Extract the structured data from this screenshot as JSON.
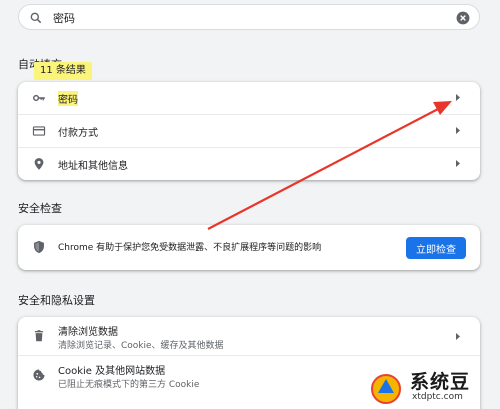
{
  "search": {
    "value": "密码",
    "icon": "search-icon",
    "clear_icon": "clear-icon"
  },
  "autofill": {
    "title": "自动填充",
    "tooltip": "11 条结果",
    "items": [
      {
        "label": "密码",
        "icon": "key-icon",
        "highlighted": true
      },
      {
        "label": "付款方式",
        "icon": "credit-card-icon"
      },
      {
        "label": "地址和其他信息",
        "icon": "location-pin-icon"
      }
    ]
  },
  "safety": {
    "title": "安全检查",
    "text": "Chrome 有助于保护您免受数据泄露、不良扩展程序等问题的影响",
    "button": "立即检查",
    "icon": "shield-icon"
  },
  "privacy": {
    "title": "安全和隐私设置",
    "items": [
      {
        "label": "清除浏览数据",
        "sub": "清除浏览记录、Cookie、缓存及其他数据",
        "icon": "trash-icon"
      },
      {
        "label": "Cookie 及其他网站数据",
        "sub": "已阻止无痕模式下的第三方 Cookie",
        "icon": "cookie-icon"
      }
    ]
  },
  "watermark": {
    "brand": "系统豆",
    "url": "xtdptc.com"
  },
  "colors": {
    "accent": "#1a73e8",
    "highlight": "#fbf47a",
    "annotation_arrow": "#e8362a",
    "background": "#f1f3f4"
  }
}
